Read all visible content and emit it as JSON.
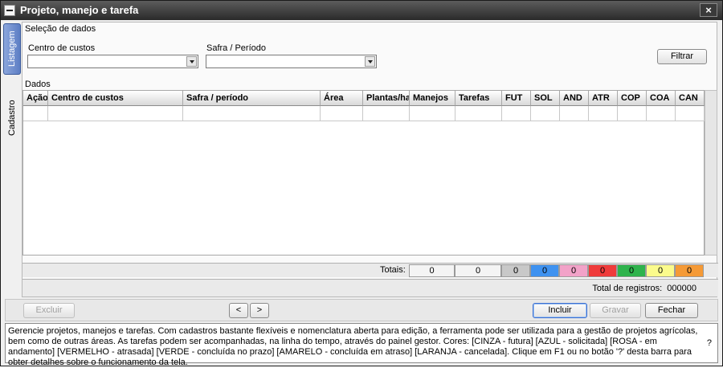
{
  "window": {
    "title": "Projeto, manejo e tarefa",
    "close_glyph": "×"
  },
  "side_tabs": {
    "listagem": "Listagem",
    "cadastro": "Cadastro"
  },
  "filters": {
    "section_label": "Seleção de dados",
    "centro_label": "Centro de custos",
    "centro_value": "",
    "safra_label": "Safra / Período",
    "safra_value": "",
    "filter_button": "Filtrar"
  },
  "data_section": {
    "label": "Dados",
    "columns": [
      "Ação",
      "Centro de custos",
      "Safra / período",
      "Área",
      "Plantas/ha",
      "Manejos",
      "Tarefas",
      "FUT",
      "SOL",
      "AND",
      "ATR",
      "COP",
      "COA",
      "CAN"
    ]
  },
  "totals": {
    "label": "Totais:",
    "manejos": "0",
    "tarefas": "0",
    "status": [
      {
        "code": "FUT",
        "value": "0",
        "color": "#c8c8c8"
      },
      {
        "code": "SOL",
        "value": "0",
        "color": "#3f92f0"
      },
      {
        "code": "AND",
        "value": "0",
        "color": "#f2a2c8"
      },
      {
        "code": "ATR",
        "value": "0",
        "color": "#ef3b3b"
      },
      {
        "code": "COP",
        "value": "0",
        "color": "#2fb34c"
      },
      {
        "code": "COA",
        "value": "0",
        "color": "#fbfb8c"
      },
      {
        "code": "CAN",
        "value": "0",
        "color": "#f59a36"
      }
    ]
  },
  "record_count": "Total de registros:  000000",
  "actions": {
    "excluir": "Excluir",
    "prev": "<",
    "next": ">",
    "incluir": "Incluir",
    "gravar": "Gravar",
    "fechar": "Fechar"
  },
  "help": {
    "text": "Gerencie projetos, manejos e tarefas. Com cadastros bastante flexíveis e nomenclatura aberta para edição, a ferramenta pode ser utilizada para a gestão de projetos agrícolas, bem como de outras áreas. As tarefas podem ser acompanhadas, na linha do tempo, através do painel gestor. Cores: [CINZA - futura] [AZUL - solicitada] [ROSA - em andamento] [VERMELHO - atrasada] [VERDE - concluída no prazo] [AMARELO - concluída em atraso] [LARANJA - cancelada]. Clique em F1 ou no botão '?' desta barra para obter detalhes sobre o funcionamento da tela.",
    "question": "?"
  }
}
